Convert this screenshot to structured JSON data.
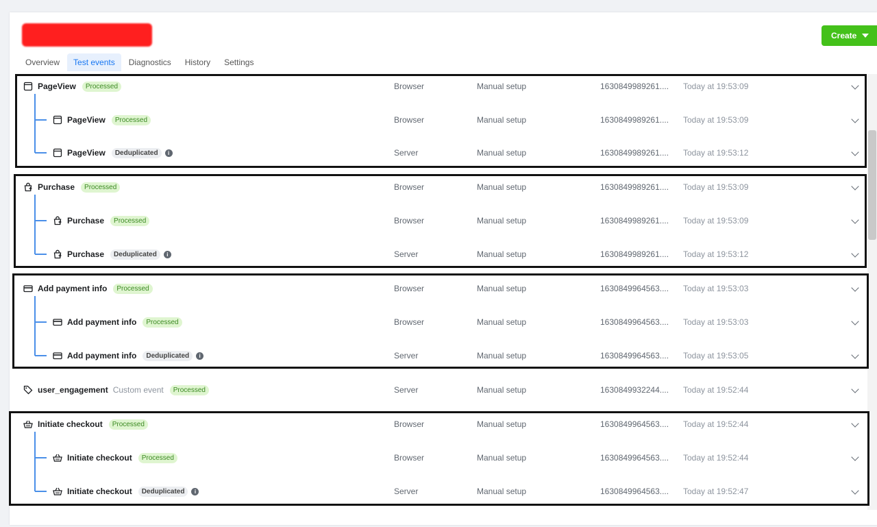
{
  "header": {
    "create_label": "Create"
  },
  "tabs": [
    {
      "label": "Overview",
      "active": false
    },
    {
      "label": "Test events",
      "active": true
    },
    {
      "label": "Diagnostics",
      "active": false
    },
    {
      "label": "History",
      "active": false
    },
    {
      "label": "Settings",
      "active": false
    }
  ],
  "colors": {
    "accent": "#1877f2",
    "create": "#44c11a",
    "processed_bg": "#dff5d0",
    "tree": "#4a8fe8"
  },
  "rows": [
    {
      "icon": "page-icon",
      "name": "PageView",
      "status": "Processed",
      "source": "Browser",
      "setup": "Manual setup",
      "event_id": "1630849989261....",
      "time": "Today at 19:53:09",
      "child": false
    },
    {
      "icon": "page-icon",
      "name": "PageView",
      "status": "Processed",
      "source": "Browser",
      "setup": "Manual setup",
      "event_id": "1630849989261....",
      "time": "Today at 19:53:09",
      "child": true
    },
    {
      "icon": "page-icon",
      "name": "PageView",
      "status": "Deduplicated",
      "source": "Server",
      "setup": "Manual setup",
      "event_id": "1630849989261....",
      "time": "Today at 19:53:12",
      "child": true
    },
    {
      "icon": "bag-icon",
      "name": "Purchase",
      "status": "Processed",
      "source": "Browser",
      "setup": "Manual setup",
      "event_id": "1630849989261....",
      "time": "Today at 19:53:09",
      "child": false
    },
    {
      "icon": "bag-icon",
      "name": "Purchase",
      "status": "Processed",
      "source": "Browser",
      "setup": "Manual setup",
      "event_id": "1630849989261....",
      "time": "Today at 19:53:09",
      "child": true
    },
    {
      "icon": "bag-icon",
      "name": "Purchase",
      "status": "Deduplicated",
      "source": "Server",
      "setup": "Manual setup",
      "event_id": "1630849989261....",
      "time": "Today at 19:53:12",
      "child": true
    },
    {
      "icon": "card-icon",
      "name": "Add payment info",
      "status": "Processed",
      "source": "Browser",
      "setup": "Manual setup",
      "event_id": "1630849964563....",
      "time": "Today at 19:53:03",
      "child": false
    },
    {
      "icon": "card-icon",
      "name": "Add payment info",
      "status": "Processed",
      "source": "Browser",
      "setup": "Manual setup",
      "event_id": "1630849964563....",
      "time": "Today at 19:53:03",
      "child": true
    },
    {
      "icon": "card-icon",
      "name": "Add payment info",
      "status": "Deduplicated",
      "source": "Server",
      "setup": "Manual setup",
      "event_id": "1630849964563....",
      "time": "Today at 19:53:05",
      "child": true
    },
    {
      "icon": "tag-icon",
      "name": "user_engagement",
      "custom_label": "Custom event",
      "status": "Processed",
      "source": "Server",
      "setup": "Manual setup",
      "event_id": "1630849932244....",
      "time": "Today at 19:52:44",
      "child": false
    },
    {
      "icon": "basket-icon",
      "name": "Initiate checkout",
      "status": "Processed",
      "source": "Browser",
      "setup": "Manual setup",
      "event_id": "1630849964563....",
      "time": "Today at 19:52:44",
      "child": false
    },
    {
      "icon": "basket-icon",
      "name": "Initiate checkout",
      "status": "Processed",
      "source": "Browser",
      "setup": "Manual setup",
      "event_id": "1630849964563....",
      "time": "Today at 19:52:44",
      "child": true
    },
    {
      "icon": "basket-icon",
      "name": "Initiate checkout",
      "status": "Deduplicated",
      "source": "Server",
      "setup": "Manual setup",
      "event_id": "1630849964563....",
      "time": "Today at 19:52:47",
      "child": true
    }
  ]
}
